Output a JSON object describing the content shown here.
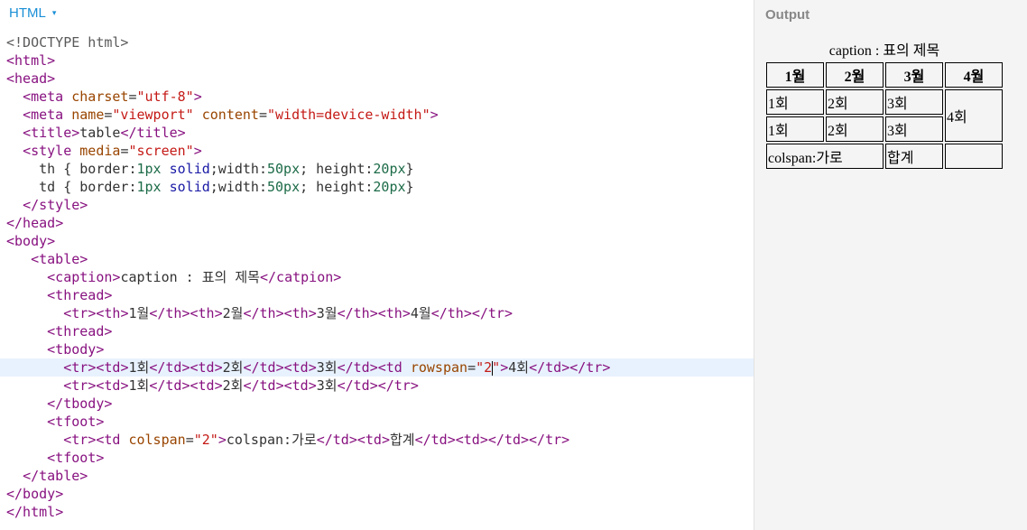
{
  "editor": {
    "language_tab": "HTML",
    "language_caret": "▾",
    "lines": [
      "<!DOCTYPE html>",
      "<html>",
      "<head>",
      "  <meta charset=\"utf-8\">",
      "  <meta name=\"viewport\" content=\"width=device-width\">",
      "  <title>table</title>",
      "  <style media=\"screen\">",
      "    th { border:1px solid;width:50px; height:20px}",
      "    td { border:1px solid;width:50px; height:20px}",
      "  </style>",
      "</head>",
      "<body>",
      "   <table>",
      "     <caption>caption : 표의 제목</catpion>",
      "     <thread>",
      "       <tr><th>1월</th><th>2월</th><th>3월</th><th>4월</th></tr>",
      "     <thread>",
      "     <tbody>",
      "       <tr><td>1회</td><td>2회</td><td>3회</td><td rowspan=\"2\">4회</td></tr>",
      "       <tr><td>1회</td><td>2회</td><td>3회</td></tr>",
      "     </tbody>",
      "     <tfoot>",
      "       <tr><td colspan=\"2\">colspan:가로</td><td>합계</td><td></td></tr>",
      "     <tfoot>",
      "  </table>",
      "</body>",
      "</html>"
    ],
    "active_line": 18
  },
  "output": {
    "title": "Output",
    "table": {
      "caption": "caption : 표의 제목",
      "headers": [
        "1월",
        "2월",
        "3월",
        "4월"
      ],
      "row1": [
        "1회",
        "2회",
        "3회",
        "4회"
      ],
      "row2": [
        "1회",
        "2회",
        "3회"
      ],
      "foot": [
        "colspan:가로",
        "합계",
        ""
      ]
    }
  },
  "colors": {
    "tag": "#881280",
    "attribute": "#994500",
    "string": "#c41a16",
    "number": "#1c6b48",
    "keyword": "#1a1aa6",
    "accent": "#1a8fd6",
    "active_line": "#e8f2fe"
  }
}
